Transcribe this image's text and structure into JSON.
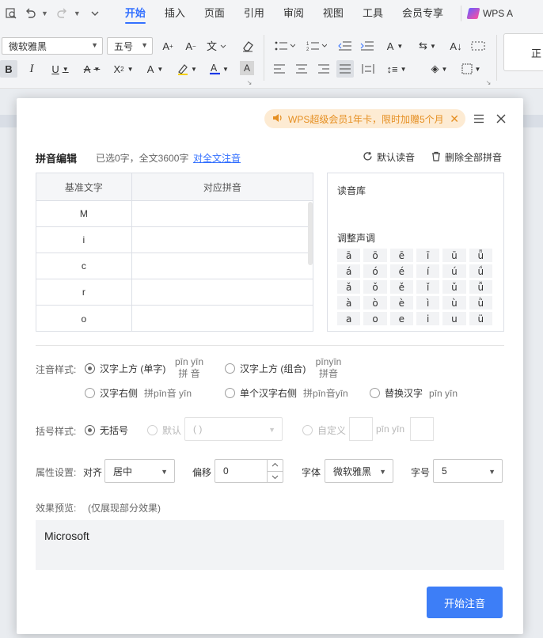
{
  "quick_access": {
    "icons": [
      "preview-icon",
      "undo-icon",
      "redo-icon",
      "more-icon"
    ]
  },
  "menu": {
    "tabs": [
      {
        "label": "开始",
        "active": true
      },
      {
        "label": "插入"
      },
      {
        "label": "页面"
      },
      {
        "label": "引用"
      },
      {
        "label": "审阅"
      },
      {
        "label": "视图"
      },
      {
        "label": "工具"
      },
      {
        "label": "会员专享"
      }
    ],
    "wps_ai": "WPS A"
  },
  "ribbon": {
    "font_name": "微软雅黑",
    "font_size": "五号",
    "style_preview": "正"
  },
  "dialog": {
    "promo": "WPS超级会员1年卡，限时加赠5个月",
    "header": {
      "title": "拼音编辑",
      "info": "已选0字，全文3600字",
      "link": "对全文注音",
      "default_reading": "默认读音",
      "delete_all": "删除全部拼音"
    },
    "table": {
      "col_base": "基准文字",
      "col_pinyin": "对应拼音",
      "rows": [
        {
          "base": "M",
          "pinyin": ""
        },
        {
          "base": "i",
          "pinyin": ""
        },
        {
          "base": "c",
          "pinyin": ""
        },
        {
          "base": "r",
          "pinyin": ""
        },
        {
          "base": "o",
          "pinyin": ""
        }
      ]
    },
    "library": {
      "title": "读音库",
      "tone_title": "调整声调",
      "tones": [
        [
          "ā",
          "ō",
          "ē",
          "ī",
          "ū",
          "ǖ"
        ],
        [
          "á",
          "ó",
          "é",
          "í",
          "ú",
          "ǘ"
        ],
        [
          "ǎ",
          "ǒ",
          "ě",
          "ǐ",
          "ǔ",
          "ǚ"
        ],
        [
          "à",
          "ò",
          "è",
          "ì",
          "ù",
          "ǜ"
        ],
        [
          "a",
          "o",
          "e",
          "i",
          "u",
          "ü"
        ]
      ]
    },
    "style": {
      "label": "注音样式:",
      "options": [
        {
          "label": "汉字上方 (单字)",
          "top": "pīn yīn",
          "bottom": "拼 音",
          "selected": true
        },
        {
          "label": "汉字上方 (组合)",
          "top": "pīnyīn",
          "bottom": "拼音"
        },
        {
          "label": "汉字右侧",
          "sample": "拼pīn音 yīn"
        },
        {
          "label": "单个汉字右侧",
          "sample": "拼pīn音yīn"
        },
        {
          "label": "替换汉字",
          "sample": "pīn yīn"
        }
      ]
    },
    "bracket": {
      "label": "括号样式:",
      "none": "无括号",
      "default": "默认",
      "default_value": "( )",
      "custom": "自定义",
      "custom_sample": "pīn yīn"
    },
    "attr": {
      "label": "属性设置:",
      "align_label": "对齐",
      "align_value": "居中",
      "offset_label": "偏移",
      "offset_value": "0",
      "font_label": "字体",
      "font_value": "微软雅黑",
      "size_label": "字号",
      "size_value": "5"
    },
    "preview": {
      "label": "效果预览:",
      "note": "(仅展现部分效果)",
      "text": "Microsoft"
    },
    "start_button": "开始注音"
  }
}
